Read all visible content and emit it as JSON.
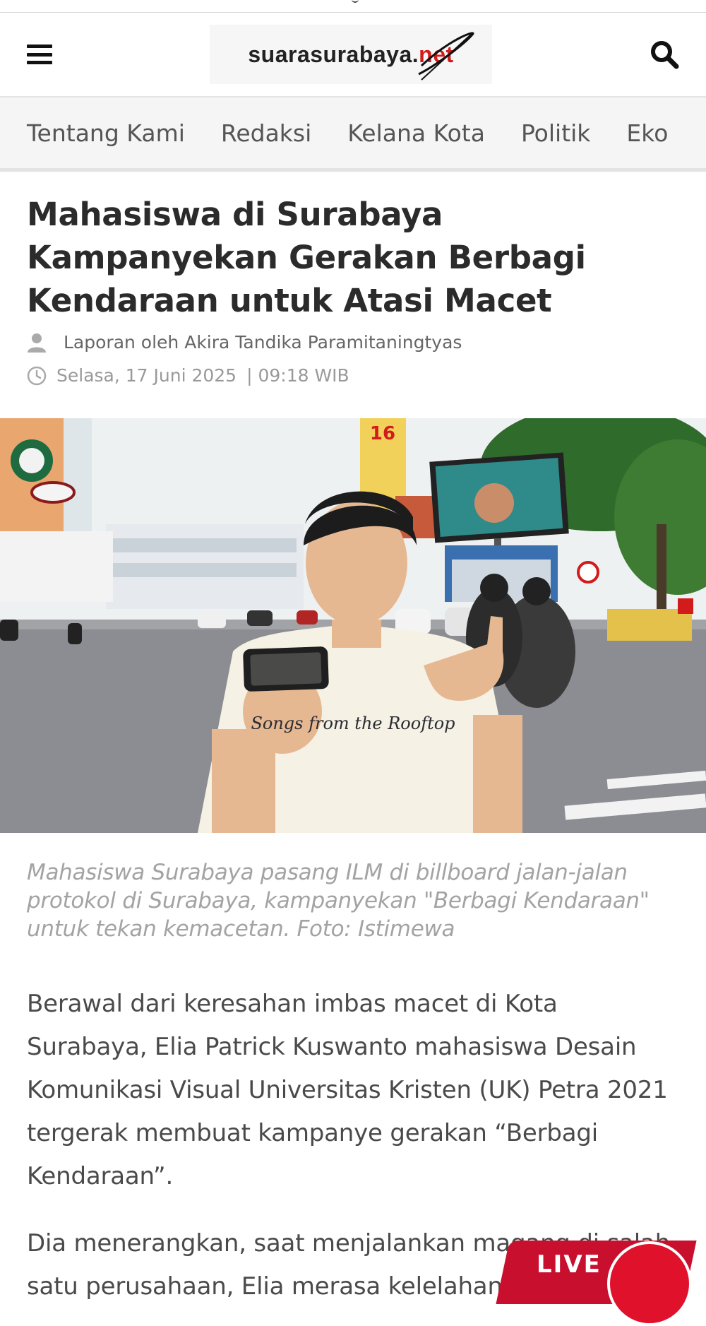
{
  "header": {
    "logo_main": "suarasurabaya.",
    "logo_accent": "net",
    "menu_icon": "hamburger-menu-icon",
    "search_icon": "search-icon"
  },
  "nav": {
    "items": [
      {
        "label": "Tentang Kami"
      },
      {
        "label": "Redaksi"
      },
      {
        "label": "Kelana Kota"
      },
      {
        "label": "Politik"
      },
      {
        "label": "Eko"
      }
    ]
  },
  "article": {
    "title": "Mahasiswa di Surabaya Kampanyekan Gerakan Berbagi Kendaraan untuk Atasi Macet",
    "author": "Laporan oleh Akira Tandika Paramitaningtyas",
    "date": "Selasa, 17 Juni 2025",
    "time": "| 09:18 WIB",
    "caption": "Mahasiswa Surabaya pasang ILM di billboard jalan-jalan protokol di Surabaya, kampanyekan \"Berbagi Kendaraan\" untuk tekan kemacetan. Foto: Istimewa",
    "paragraphs": [
      "Berawal dari keresahan imbas macet di Kota Surabaya, Elia Patrick Kuswanto mahasiswa Desain Komunikasi Visual Universitas Kristen (UK) Petra 2021 tergerak membuat kampanye gerakan “Berbagi Kendaraan”.",
      "Dia menerangkan, saat menjalankan magang di salah satu perusahaan, Elia merasa kelelahan k"
    ]
  },
  "hero_image": {
    "banner_number": "16",
    "shirt_text": "Songs from the Rooftop"
  },
  "live_badge": {
    "label": "LIVE"
  },
  "colors": {
    "logo_accent": "#d21b1b",
    "live_red": "#c8102e",
    "nav_bg": "#f5f5f5",
    "caption_gray": "#a3a3a3"
  }
}
